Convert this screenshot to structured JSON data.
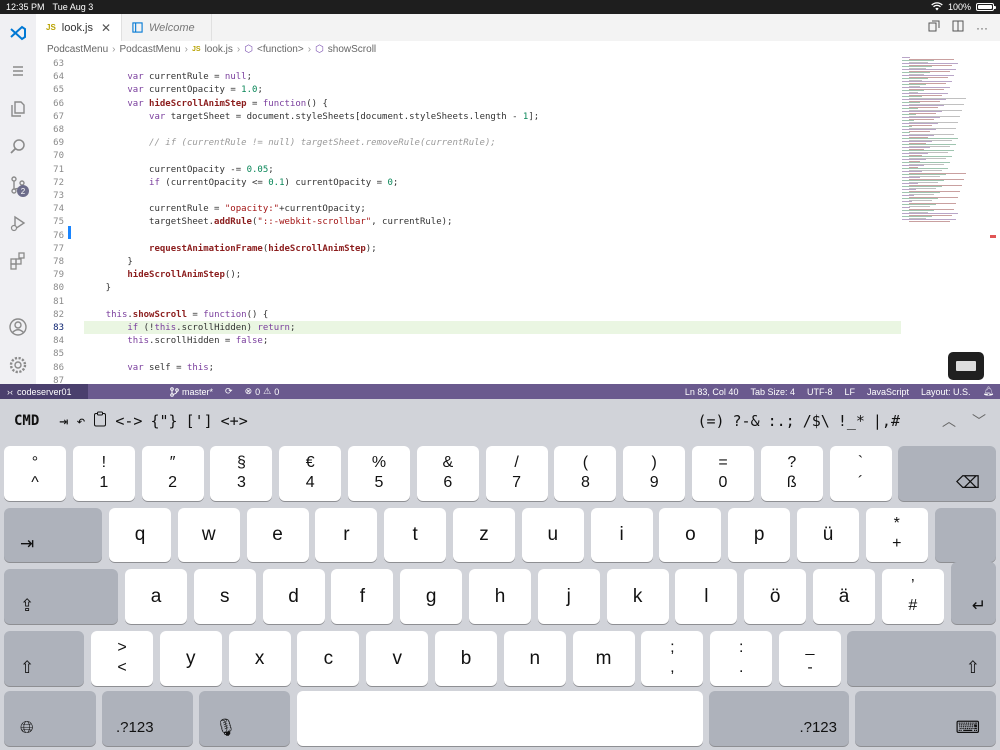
{
  "ios": {
    "time": "12:35 PM",
    "date": "Tue Aug 3",
    "battery": "100%",
    "battery_level": 1.0
  },
  "tabs": [
    {
      "name": "look.js",
      "prefix": "JS",
      "active": true
    },
    {
      "name": "Welcome",
      "active": false
    }
  ],
  "breadcrumbs": [
    "PodcastMenu",
    "PodcastMenu",
    "look.js",
    "<function>",
    "showScroll"
  ],
  "code_lines": [
    {
      "n": "63",
      "text": ""
    },
    {
      "n": "64",
      "text": "        var currentRule = null;"
    },
    {
      "n": "65",
      "text": "        var currentOpacity = 1.0;"
    },
    {
      "n": "66",
      "text": "        var hideScrollAnimStep = function() {"
    },
    {
      "n": "67",
      "text": "            var targetSheet = document.styleSheets[document.styleSheets.length - 1];"
    },
    {
      "n": "68",
      "text": ""
    },
    {
      "n": "69",
      "text": "            // if (currentRule != null) targetSheet.removeRule(currentRule);"
    },
    {
      "n": "70",
      "text": ""
    },
    {
      "n": "71",
      "text": "            currentOpacity -= 0.05;"
    },
    {
      "n": "72",
      "text": "            if (currentOpacity <= 0.1) currentOpacity = 0;"
    },
    {
      "n": "73",
      "text": ""
    },
    {
      "n": "74",
      "text": "            currentRule = \"opacity:\"+currentOpacity;"
    },
    {
      "n": "75",
      "text": "            targetSheet.addRule(\"::-webkit-scrollbar\", currentRule);"
    },
    {
      "n": "76",
      "text": ""
    },
    {
      "n": "77",
      "text": "            requestAnimationFrame(hideScrollAnimStep);"
    },
    {
      "n": "78",
      "text": "        }"
    },
    {
      "n": "79",
      "text": "        hideScrollAnimStep();"
    },
    {
      "n": "80",
      "text": "    }"
    },
    {
      "n": "81",
      "text": ""
    },
    {
      "n": "82",
      "text": "    this.showScroll = function() {"
    },
    {
      "n": "83",
      "text": "        if (!this.scrollHidden) return;"
    },
    {
      "n": "84",
      "text": "        this.scrollHidden = false;"
    },
    {
      "n": "85",
      "text": ""
    },
    {
      "n": "86",
      "text": "        var self = this;"
    },
    {
      "n": "87",
      "text": ""
    }
  ],
  "current_line": "83",
  "activity": {
    "source_control_badge": "2"
  },
  "statusbar": {
    "remote": "codeserver01",
    "branch": "master*",
    "problems": "0",
    "warnings": "0",
    "position": "Ln 83, Col 40",
    "tab_size": "Tab Size: 4",
    "encoding": "UTF-8",
    "eol": "LF",
    "language": "JavaScript",
    "layout": "Layout: U.S."
  },
  "toolbar": {
    "cmd": "CMD",
    "tab": "⇥",
    "left_items": [
      "<->",
      "{\"}",
      "[']",
      "<+>"
    ],
    "right_items": [
      "(=)",
      "?-&",
      ":.;",
      "/$\\",
      "!_*",
      "|,#"
    ]
  },
  "keyboard": {
    "row1": [
      {
        "top": "°",
        "bot": "^"
      },
      {
        "top": "!",
        "bot": "1"
      },
      {
        "top": "″",
        "bot": "2"
      },
      {
        "top": "§",
        "bot": "3"
      },
      {
        "top": "€",
        "bot": "4"
      },
      {
        "top": "%",
        "bot": "5"
      },
      {
        "top": "&",
        "bot": "6"
      },
      {
        "top": "/",
        "bot": "7"
      },
      {
        "top": "(",
        "bot": "8"
      },
      {
        "top": ")",
        "bot": "9"
      },
      {
        "top": "=",
        "bot": "0"
      },
      {
        "top": "?",
        "bot": "ß"
      },
      {
        "top": "`",
        "bot": "´"
      }
    ],
    "row2": [
      "q",
      "w",
      "e",
      "r",
      "t",
      "z",
      "u",
      "i",
      "o",
      "p",
      "ü",
      {
        "top": "*",
        "bot": "+"
      }
    ],
    "row3": [
      "a",
      "s",
      "d",
      "f",
      "g",
      "h",
      "j",
      "k",
      "l",
      "ö",
      "ä",
      {
        "top": "’",
        "bot": "#"
      }
    ],
    "row4": [
      {
        "top": ">",
        "bot": "<"
      },
      "y",
      "x",
      "c",
      "v",
      "b",
      "n",
      "m",
      {
        "top": ";",
        "bot": ","
      },
      {
        "top": ":",
        "bot": "."
      },
      {
        "top": "_",
        "bot": "-"
      }
    ],
    "numbers_label": ".?123",
    "numbers_label_right": ".?123"
  }
}
